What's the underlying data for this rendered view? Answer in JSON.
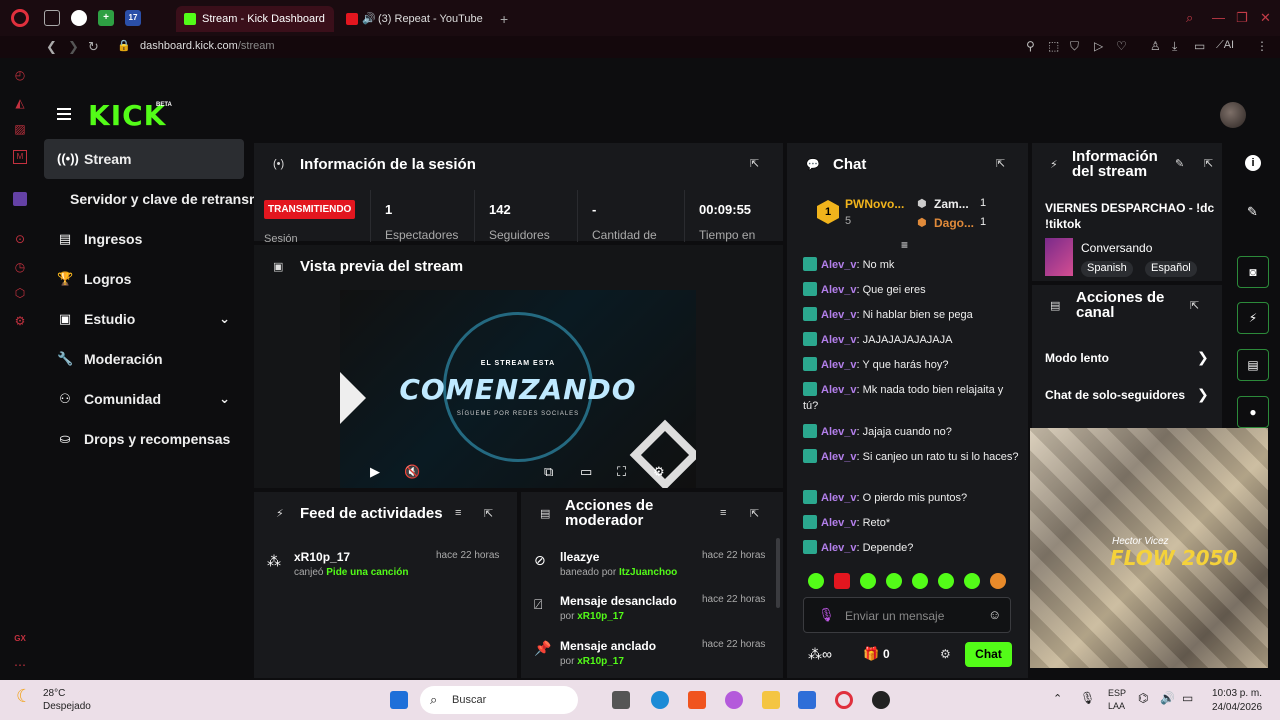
{
  "browser": {
    "tabs": [
      {
        "title": "Stream - Kick Dashboard",
        "active": true
      },
      {
        "title": "(3) Repeat - YouTube",
        "active": false
      }
    ],
    "url_domain": "dashboard.kick.com",
    "url_path": "/stream",
    "pinned_badge": "17",
    "ai_label": "AI",
    "gx_label": "GX"
  },
  "header": {
    "logo": "KICK",
    "beta": "BETA"
  },
  "sidebar": {
    "items": [
      {
        "label": "Stream",
        "icon": "broadcast-icon",
        "active": true
      },
      {
        "label": "Servidor y clave de retransm",
        "icon": "",
        "active": false
      },
      {
        "label": "Ingresos",
        "icon": "chart-icon",
        "active": false
      },
      {
        "label": "Logros",
        "icon": "trophy-icon",
        "active": false
      },
      {
        "label": "Estudio",
        "icon": "studio-icon",
        "active": false,
        "expandable": true
      },
      {
        "label": "Moderación",
        "icon": "wrench-icon",
        "active": false
      },
      {
        "label": "Comunidad",
        "icon": "community-icon",
        "active": false,
        "expandable": true
      },
      {
        "label": "Drops y recompensas",
        "icon": "drops-icon",
        "active": false
      }
    ]
  },
  "session": {
    "title": "Información de la sesión",
    "status": "TRANSMITIENDO",
    "status_label": "Sesión",
    "stats": [
      {
        "value": "1",
        "label": "Espectadores"
      },
      {
        "value": "142",
        "label": "Seguidores"
      },
      {
        "value": "-",
        "label": "Cantidad de"
      },
      {
        "value": "00:09:55",
        "label": "Tiempo en"
      }
    ]
  },
  "preview": {
    "title": "Vista previa del stream",
    "small_text": "EL STREAM ESTA",
    "big_text": "COMENZANDO",
    "sub_text": "SÍGUEME POR REDES SOCIALES"
  },
  "feed": {
    "title": "Feed de actividades",
    "items": [
      {
        "user": "xR10p_17",
        "action": "canjeó",
        "highlight": "Pide una canción",
        "time": "hace 22 horas"
      }
    ]
  },
  "mod_actions": {
    "title": "Acciones de moderador",
    "items": [
      {
        "title": "lleazye",
        "prefix": "baneado por",
        "by": "ItzJuanchoo",
        "time": "hace 22 horas",
        "icon": "ban-icon"
      },
      {
        "title": "Mensaje desanclado",
        "prefix": "por",
        "by": "xR10p_17",
        "time": "hace 22 horas",
        "icon": "unpin-icon"
      },
      {
        "title": "Mensaje anclado",
        "prefix": "por",
        "by": "xR10p_17",
        "time": "hace 22 horas",
        "icon": "pin-icon"
      }
    ]
  },
  "chat": {
    "title": "Chat",
    "top": [
      {
        "rank": "1",
        "name": "PWNovo...",
        "count": "5"
      },
      {
        "name": "Zam...",
        "count": "1"
      },
      {
        "name": "Dago...",
        "count": "1"
      }
    ],
    "messages": [
      {
        "user": "Alev_v",
        "text": "No mk"
      },
      {
        "user": "Alev_v",
        "text": "Que gei eres"
      },
      {
        "user": "Alev_v",
        "text": "Ni hablar bien se pega"
      },
      {
        "user": "Alev_v",
        "text": "JAJAJAJAJAJAJA"
      },
      {
        "user": "Alev_v",
        "text": "Y que harás hoy?"
      },
      {
        "user": "Alev_v",
        "text": "Mk nada todo bien relajaita y tú?"
      },
      {
        "user": "Alev_v",
        "text": "Jajaja cuando no?"
      },
      {
        "user": "Alev_v",
        "text": "Si canjeo un rato tu si lo haces?"
      },
      {
        "user": "Alev_v",
        "text": "O pierdo mis puntos?"
      },
      {
        "user": "Alev_v",
        "text": "Reto*"
      },
      {
        "user": "Alev_v",
        "text": "Depende?"
      }
    ],
    "input_placeholder": "Enviar un mensaje",
    "points": "0",
    "send_label": "Chat"
  },
  "stream_info": {
    "title_line1": "Información",
    "title_line2": "del stream",
    "stream_title": "VIERNES DESPARCHAO - !dc !tiktok",
    "category": "Conversando",
    "tags": [
      "Spanish",
      "Español"
    ]
  },
  "channel_actions": {
    "title_line1": "Acciones de",
    "title_line2": "canal",
    "items": [
      "Modo lento",
      "Chat de solo-seguidores"
    ]
  },
  "album": {
    "line1": "Hector Vicez",
    "line2": "FLOW 2050"
  },
  "taskbar": {
    "weather_temp": "28°C",
    "weather_desc": "Despejado",
    "search_placeholder": "Buscar",
    "lang1": "ESP",
    "lang2": "LAA",
    "time": "10:03 p. m.",
    "date": "24/04/2026"
  }
}
